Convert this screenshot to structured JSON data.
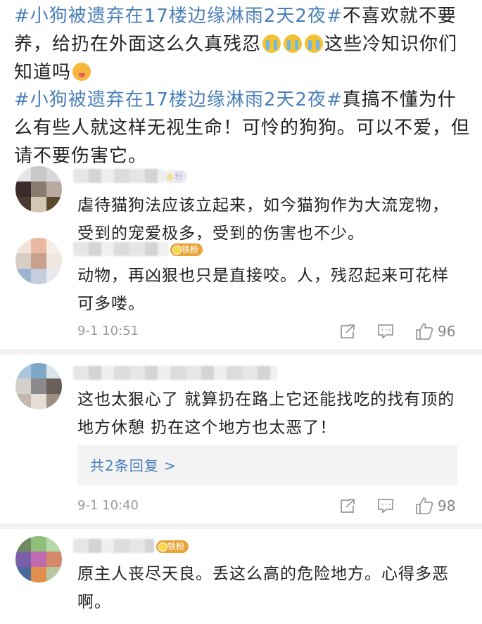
{
  "reposts": [
    {
      "hashtag": "#小狗被遗弃在17楼边缘淋雨2天2夜#",
      "text_a": "不喜欢就不要养，给扔在外面这么久真残忍",
      "emojis": [
        "crying-face",
        "crying-face",
        "crying-face"
      ],
      "text_b": "这些冷知识你们知道吗",
      "end_emoji": "yum-face"
    },
    {
      "hashtag": "#小狗被遗弃在17楼边缘淋雨2天2夜#",
      "text_a": "真搞不懂为什么有些人就这样无视生命！可怜的狗狗。可以不爱，但请不要伤害它。"
    }
  ],
  "comments": [
    {
      "badge": "粉",
      "text": "虐待猫狗法应该立起来，如今猫狗作为大流宠物，受到的宠爱极多，受到的伤害也不少。",
      "avatar_colors": [
        "#e5e5e5",
        "#c8c8c8",
        "#d8d8d8",
        "#3a2a2a",
        "#8a7b6f",
        "#b8aaa0",
        "#4a3a30",
        "#d2c8b4",
        "#5c4a2e"
      ]
    },
    {
      "badge": "铁粉",
      "text": "动物，再凶狠也只是直接咬。人，残忍起来可花样可多喽。",
      "timestamp": "9-1 10:51",
      "likes": "96",
      "avatar_colors": [
        "#f0e2d8",
        "#e8b8a0",
        "#f4eee8",
        "#d8cec4",
        "#c7a18c",
        "#efe7e0",
        "#9db4d0",
        "#c4cedd",
        "#e8eaee"
      ]
    },
    {
      "badge": "",
      "text": "这也太狠心了 就算扔在路上它还能找吃的找有顶的地方休憩 扔在这个地方也太恶了！",
      "reply_link": "共2条回复 >",
      "timestamp": "9-1 10:40",
      "likes": "98",
      "avatar_colors": [
        "#a9c6dc",
        "#7fa8c6",
        "#d8e4ee",
        "#d4d0cc",
        "#8a8a8a",
        "#6a5e58",
        "#c4b8ae",
        "#e6ddd5",
        "#9e8f84"
      ]
    },
    {
      "badge": "铁粉",
      "text": "原主人丧尽天良。丢这么高的危险地方。心得多恶啊。",
      "avatar_colors": [
        "#6e8a5e",
        "#8fbf7a",
        "#b4d8a6",
        "#7a5ea8",
        "#c06ab0",
        "#d48a6a",
        "#4a6a9c",
        "#e0904c",
        "#b8c8a0"
      ]
    }
  ]
}
